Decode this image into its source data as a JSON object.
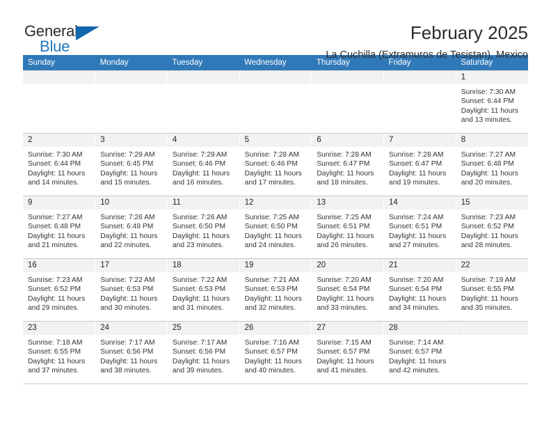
{
  "brand": {
    "name_top": "General",
    "name_bottom": "Blue",
    "triangle_color": "#1266ad",
    "blue_color": "#1f77c2"
  },
  "header": {
    "title": "February 2025",
    "subtitle": "La Cuchilla (Extramuros de Tesistan), Mexico"
  },
  "theme": {
    "header_row_bg": "#3079b8",
    "daynum_bg": "#f2f2f2",
    "grid_line": "#c8c8c8"
  },
  "calendar": {
    "weekday_headers": [
      "Sunday",
      "Monday",
      "Tuesday",
      "Wednesday",
      "Thursday",
      "Friday",
      "Saturday"
    ],
    "weeks": [
      [
        {
          "day": "",
          "sunrise": "",
          "sunset": "",
          "daylight": ""
        },
        {
          "day": "",
          "sunrise": "",
          "sunset": "",
          "daylight": ""
        },
        {
          "day": "",
          "sunrise": "",
          "sunset": "",
          "daylight": ""
        },
        {
          "day": "",
          "sunrise": "",
          "sunset": "",
          "daylight": ""
        },
        {
          "day": "",
          "sunrise": "",
          "sunset": "",
          "daylight": ""
        },
        {
          "day": "",
          "sunrise": "",
          "sunset": "",
          "daylight": ""
        },
        {
          "day": "1",
          "sunrise": "Sunrise: 7:30 AM",
          "sunset": "Sunset: 6:44 PM",
          "daylight": "Daylight: 11 hours and 13 minutes."
        }
      ],
      [
        {
          "day": "2",
          "sunrise": "Sunrise: 7:30 AM",
          "sunset": "Sunset: 6:44 PM",
          "daylight": "Daylight: 11 hours and 14 minutes."
        },
        {
          "day": "3",
          "sunrise": "Sunrise: 7:29 AM",
          "sunset": "Sunset: 6:45 PM",
          "daylight": "Daylight: 11 hours and 15 minutes."
        },
        {
          "day": "4",
          "sunrise": "Sunrise: 7:29 AM",
          "sunset": "Sunset: 6:46 PM",
          "daylight": "Daylight: 11 hours and 16 minutes."
        },
        {
          "day": "5",
          "sunrise": "Sunrise: 7:28 AM",
          "sunset": "Sunset: 6:46 PM",
          "daylight": "Daylight: 11 hours and 17 minutes."
        },
        {
          "day": "6",
          "sunrise": "Sunrise: 7:28 AM",
          "sunset": "Sunset: 6:47 PM",
          "daylight": "Daylight: 11 hours and 18 minutes."
        },
        {
          "day": "7",
          "sunrise": "Sunrise: 7:28 AM",
          "sunset": "Sunset: 6:47 PM",
          "daylight": "Daylight: 11 hours and 19 minutes."
        },
        {
          "day": "8",
          "sunrise": "Sunrise: 7:27 AM",
          "sunset": "Sunset: 6:48 PM",
          "daylight": "Daylight: 11 hours and 20 minutes."
        }
      ],
      [
        {
          "day": "9",
          "sunrise": "Sunrise: 7:27 AM",
          "sunset": "Sunset: 6:48 PM",
          "daylight": "Daylight: 11 hours and 21 minutes."
        },
        {
          "day": "10",
          "sunrise": "Sunrise: 7:26 AM",
          "sunset": "Sunset: 6:49 PM",
          "daylight": "Daylight: 11 hours and 22 minutes."
        },
        {
          "day": "11",
          "sunrise": "Sunrise: 7:26 AM",
          "sunset": "Sunset: 6:50 PM",
          "daylight": "Daylight: 11 hours and 23 minutes."
        },
        {
          "day": "12",
          "sunrise": "Sunrise: 7:25 AM",
          "sunset": "Sunset: 6:50 PM",
          "daylight": "Daylight: 11 hours and 24 minutes."
        },
        {
          "day": "13",
          "sunrise": "Sunrise: 7:25 AM",
          "sunset": "Sunset: 6:51 PM",
          "daylight": "Daylight: 11 hours and 26 minutes."
        },
        {
          "day": "14",
          "sunrise": "Sunrise: 7:24 AM",
          "sunset": "Sunset: 6:51 PM",
          "daylight": "Daylight: 11 hours and 27 minutes."
        },
        {
          "day": "15",
          "sunrise": "Sunrise: 7:23 AM",
          "sunset": "Sunset: 6:52 PM",
          "daylight": "Daylight: 11 hours and 28 minutes."
        }
      ],
      [
        {
          "day": "16",
          "sunrise": "Sunrise: 7:23 AM",
          "sunset": "Sunset: 6:52 PM",
          "daylight": "Daylight: 11 hours and 29 minutes."
        },
        {
          "day": "17",
          "sunrise": "Sunrise: 7:22 AM",
          "sunset": "Sunset: 6:53 PM",
          "daylight": "Daylight: 11 hours and 30 minutes."
        },
        {
          "day": "18",
          "sunrise": "Sunrise: 7:22 AM",
          "sunset": "Sunset: 6:53 PM",
          "daylight": "Daylight: 11 hours and 31 minutes."
        },
        {
          "day": "19",
          "sunrise": "Sunrise: 7:21 AM",
          "sunset": "Sunset: 6:53 PM",
          "daylight": "Daylight: 11 hours and 32 minutes."
        },
        {
          "day": "20",
          "sunrise": "Sunrise: 7:20 AM",
          "sunset": "Sunset: 6:54 PM",
          "daylight": "Daylight: 11 hours and 33 minutes."
        },
        {
          "day": "21",
          "sunrise": "Sunrise: 7:20 AM",
          "sunset": "Sunset: 6:54 PM",
          "daylight": "Daylight: 11 hours and 34 minutes."
        },
        {
          "day": "22",
          "sunrise": "Sunrise: 7:19 AM",
          "sunset": "Sunset: 6:55 PM",
          "daylight": "Daylight: 11 hours and 35 minutes."
        }
      ],
      [
        {
          "day": "23",
          "sunrise": "Sunrise: 7:18 AM",
          "sunset": "Sunset: 6:55 PM",
          "daylight": "Daylight: 11 hours and 37 minutes."
        },
        {
          "day": "24",
          "sunrise": "Sunrise: 7:17 AM",
          "sunset": "Sunset: 6:56 PM",
          "daylight": "Daylight: 11 hours and 38 minutes."
        },
        {
          "day": "25",
          "sunrise": "Sunrise: 7:17 AM",
          "sunset": "Sunset: 6:56 PM",
          "daylight": "Daylight: 11 hours and 39 minutes."
        },
        {
          "day": "26",
          "sunrise": "Sunrise: 7:16 AM",
          "sunset": "Sunset: 6:57 PM",
          "daylight": "Daylight: 11 hours and 40 minutes."
        },
        {
          "day": "27",
          "sunrise": "Sunrise: 7:15 AM",
          "sunset": "Sunset: 6:57 PM",
          "daylight": "Daylight: 11 hours and 41 minutes."
        },
        {
          "day": "28",
          "sunrise": "Sunrise: 7:14 AM",
          "sunset": "Sunset: 6:57 PM",
          "daylight": "Daylight: 11 hours and 42 minutes."
        },
        {
          "day": "",
          "sunrise": "",
          "sunset": "",
          "daylight": ""
        }
      ]
    ]
  }
}
